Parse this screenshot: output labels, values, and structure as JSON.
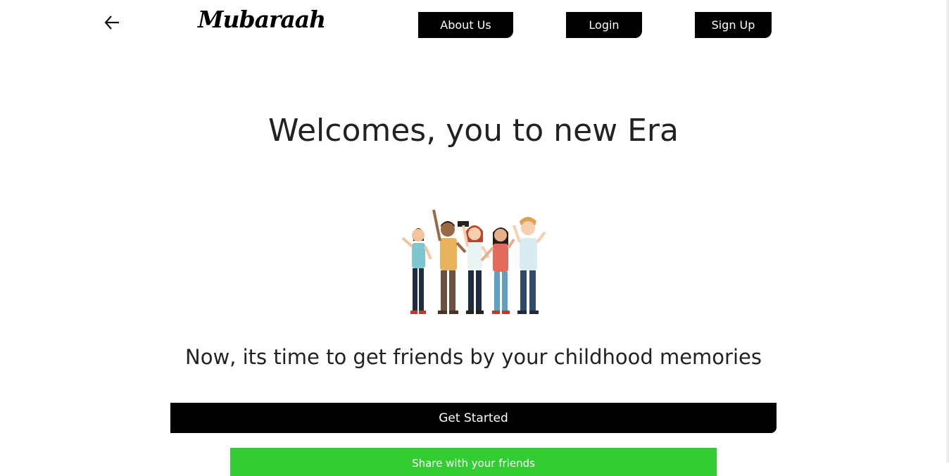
{
  "header": {
    "logo": "Mubaraah",
    "nav": {
      "about_label": "About Us",
      "login_label": "Login",
      "signup_label": "Sign Up"
    }
  },
  "hero": {
    "headline": "Welcomes, you to new Era",
    "illustration_icon": "group-of-friends-illustration",
    "subline": "Now, its time to get friends by your childhood memories"
  },
  "actions": {
    "get_started_label": "Get Started",
    "share_label": "Share with your friends"
  },
  "colors": {
    "primary": "#000000",
    "share_green": "#33cc33",
    "text": "#222222"
  }
}
